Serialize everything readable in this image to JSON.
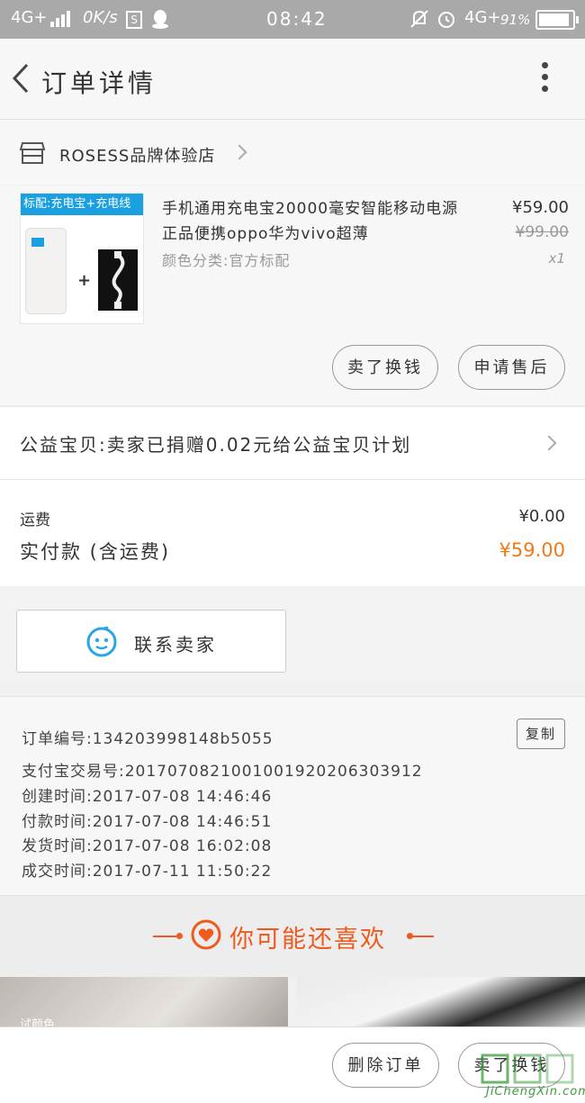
{
  "status_bar": {
    "network_left": "4G+",
    "speed": "0K/s",
    "time": "08:42",
    "network_right": "4G+",
    "battery": "91%",
    "icons": [
      "signal-icon",
      "sim-s-icon",
      "qq-icon",
      "mute-icon",
      "alarm-icon",
      "battery-icon"
    ]
  },
  "nav": {
    "title": "订单详情",
    "icons": [
      "back-arrow-icon",
      "more-dots-icon"
    ]
  },
  "store": {
    "name": "ROSESS品牌体验店",
    "icons": [
      "store-icon",
      "chevron-right-icon"
    ]
  },
  "product": {
    "image_tag": "标配:充电宝+充电线",
    "image_plus": "+",
    "title": "手机通用充电宝20000毫安智能移动电源正品便携oppo华为vivo超薄",
    "sku": "颜色分类:官方标配",
    "price": "¥59.00",
    "original_price": "¥99.00",
    "quantity": "x1",
    "buttons": {
      "sell_swap": "卖了换钱",
      "after_sale": "申请售后"
    }
  },
  "charity": {
    "text": "公益宝贝:卖家已捐赠0.02元给公益宝贝计划"
  },
  "payment": {
    "shipping_label": "运费",
    "shipping_value": "¥0.00",
    "paid_label": "实付款 (含运费)",
    "paid_value": "¥59.00"
  },
  "contact": {
    "label": "联系卖家"
  },
  "order_info": {
    "rows": [
      "订单编号:134203998148b5055",
      "支付宝交易号:2017070821001001920206303912",
      "创建时间:2017-07-08 14:46:46",
      "付款时间:2017-07-08 14:46:51",
      "发货时间:2017-07-08 16:02:08",
      "成交时间:2017-07-11 11:50:22"
    ],
    "copy_label": "复制"
  },
  "recommend": {
    "title": "你可能还喜欢",
    "caption": "试颜色"
  },
  "bottom_bar": {
    "delete_order": "删除订单",
    "sell_swap": "卖了换钱"
  },
  "watermark": {
    "text": "JiChengXin.com"
  },
  "colors": {
    "accent_orange": "#ef5a1e",
    "price_orange": "#f07a18",
    "status_bar": "#a9a9a9",
    "chat_blue": "#2aa6e8"
  }
}
